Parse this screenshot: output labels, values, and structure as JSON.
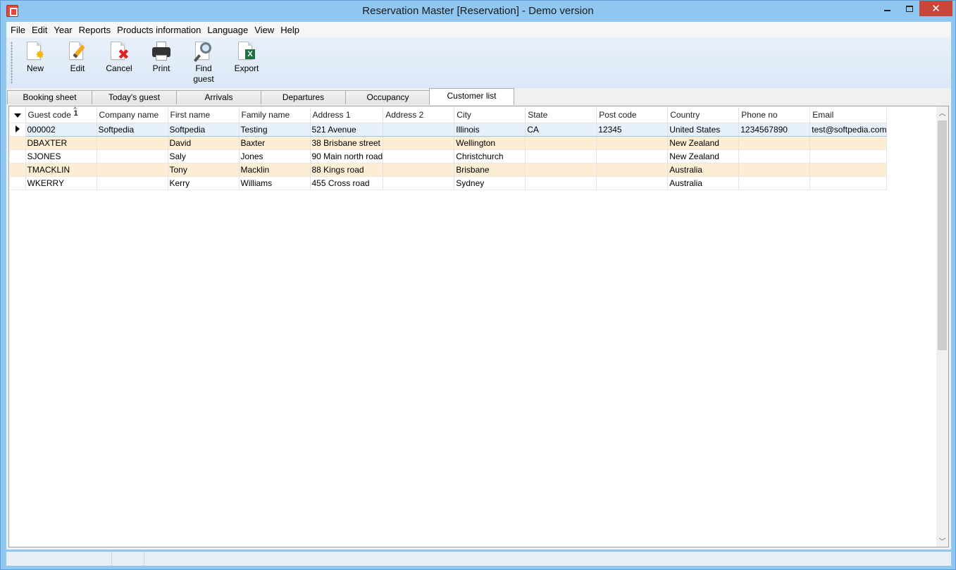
{
  "window": {
    "title": "Reservation Master [Reservation] - Demo version",
    "close_glyph": "✕"
  },
  "menu": [
    "File",
    "Edit",
    "Year",
    "Reports",
    "Products information",
    "Language",
    "View",
    "Help"
  ],
  "toolbar": {
    "buttons": [
      {
        "label": "New",
        "icon": "new-document-icon"
      },
      {
        "label": "Edit",
        "icon": "edit-pencil-icon"
      },
      {
        "label": "Cancel",
        "icon": "cancel-x-icon"
      },
      {
        "label": "Print",
        "icon": "printer-icon"
      },
      {
        "label": "Find\nguest",
        "icon": "magnifier-icon"
      },
      {
        "label": "Export",
        "icon": "excel-export-icon"
      }
    ]
  },
  "tabs": {
    "items": [
      "Booking sheet",
      "Today's guest",
      "Arrivals",
      "Departures",
      "Occupancy",
      "Customer list"
    ],
    "active": "Customer list"
  },
  "grid": {
    "sort_indicator": "1",
    "columns": [
      "Guest code",
      "Company name",
      "First name",
      "Family name",
      "Address 1",
      "Address 2",
      "City",
      "State",
      "Post code",
      "Country",
      "Phone no",
      "Email"
    ],
    "rows": [
      [
        "000002",
        "Softpedia",
        "Softpedia",
        "Testing",
        "521 Avenue",
        "",
        "Illinois",
        "CA",
        "12345",
        "United States",
        "1234567890",
        "test@softpedia.com"
      ],
      [
        "DBAXTER",
        "",
        "David",
        "Baxter",
        "38 Brisbane street",
        "",
        "Wellington",
        "",
        "",
        "New Zealand",
        "",
        ""
      ],
      [
        "SJONES",
        "",
        "Saly",
        "Jones",
        "90 Main north road",
        "",
        "Christchurch",
        "",
        "",
        "New Zealand",
        "",
        ""
      ],
      [
        "TMACKLIN",
        "",
        "Tony",
        "Macklin",
        "88 Kings road",
        "",
        "Brisbane",
        "",
        "",
        "Australia",
        "",
        ""
      ],
      [
        "WKERRY",
        "",
        "Kerry",
        "Williams",
        "455 Cross road",
        "",
        "Sydney",
        "",
        "",
        "Australia",
        "",
        ""
      ]
    ],
    "selected_row": 0
  },
  "colors": {
    "titlebar": "#8fc7f0",
    "close_button": "#c7473b",
    "alt_row": "#fbeed4",
    "selected_row": "#e6f1fb"
  }
}
